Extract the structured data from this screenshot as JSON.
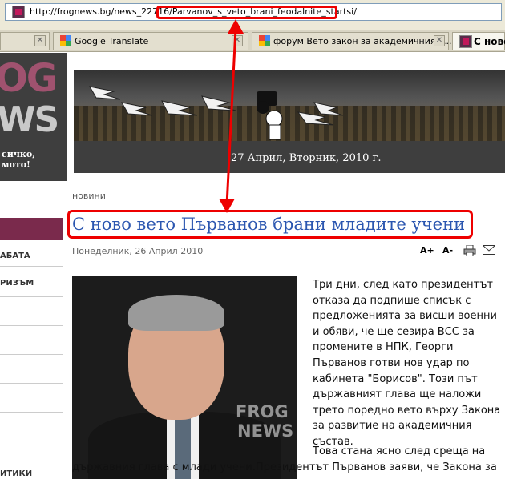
{
  "browser": {
    "url": "http://frognews.bg/news_22716/Parvanov_s_veto_brani_feodalnite_startsi/",
    "tabs": [
      {
        "label": ""
      },
      {
        "label": "Google Translate"
      },
      {
        "label": "форум Вето закон за академичния с..."
      },
      {
        "label": "С ново"
      }
    ]
  },
  "site": {
    "logo_top": "OG",
    "logo_bottom": "WS",
    "slogan_line1": "сичко,",
    "slogan_line2": "мото!",
    "date": "27 Април, Вторник, 2010 г."
  },
  "nav": {
    "items": [
      "АБАТА",
      "РИЗЪМ",
      "ИТИКИ"
    ]
  },
  "article": {
    "category": "новини",
    "title": "С ново вето Първанов брани младите учени",
    "date": "Понеделник, 26 Април 2010",
    "font_increase": "A+",
    "font_decrease": "A-",
    "paragraph1": "Три дни, след като президентът отказа да подпише списък с предложенията за висши военни и обяви, че ще сезира ВСС за промените в НПК, Георги Първанов готви нов удар по кабинета \"Борисов\". Този път държавният глава ще наложи трето поредно вето върху Закона за развитие на академичния състав.",
    "paragraph2_start": "Това стана ясно след среща на",
    "paragraph2_rest": "държавния глава с млади учени.Президентът Първанов заяви, че Закона за",
    "photo_watermark_1": "FROG",
    "photo_watermark_2": "NEWS"
  },
  "colors": {
    "highlight": "#ee0000",
    "title_link": "#2b56b0",
    "accent": "#7a2a4c"
  }
}
